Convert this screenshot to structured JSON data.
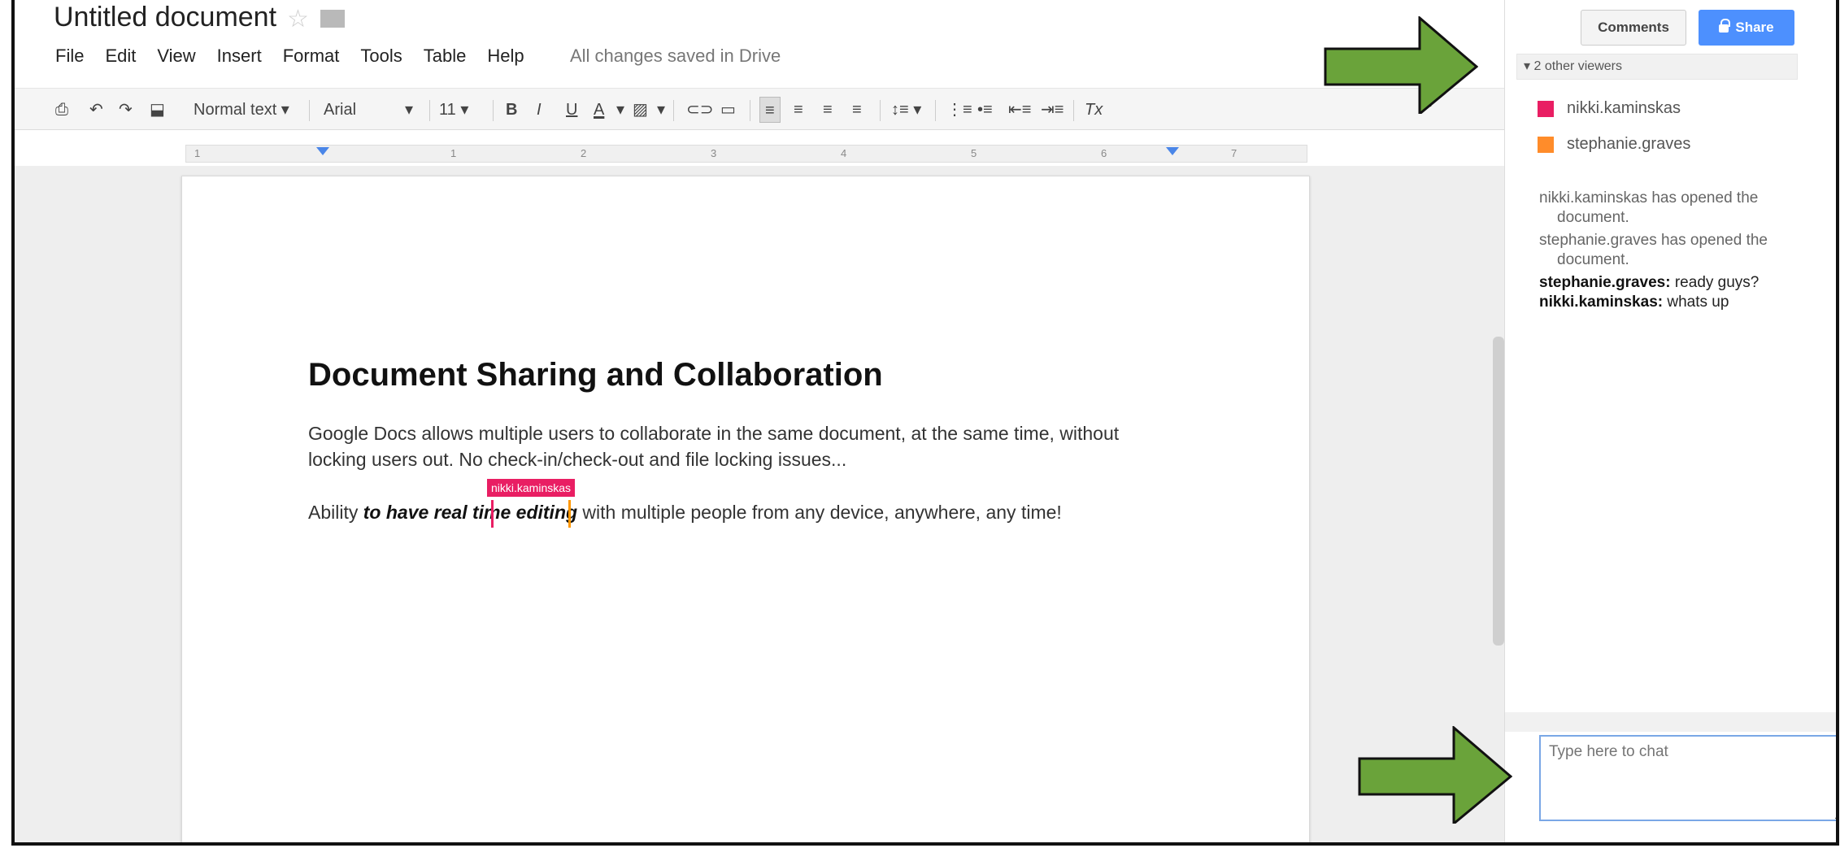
{
  "document": {
    "title": "Untitled document",
    "save_status": "All changes saved in Drive"
  },
  "menu": [
    "File",
    "Edit",
    "View",
    "Insert",
    "Format",
    "Tools",
    "Table",
    "Help"
  ],
  "toolbar": {
    "style": "Normal text",
    "font": "Arial",
    "size": "11",
    "bold": "B",
    "italic": "I",
    "underline": "U",
    "text_color": "A"
  },
  "ruler": [
    "1",
    "1",
    "2",
    "3",
    "4",
    "5",
    "6",
    "7"
  ],
  "page": {
    "heading": "Document Sharing and Collaboration",
    "paragraph1": "Google Docs allows multiple users to collaborate in the same document, at the same time, without locking users out. No check-in/check-out and file locking issues...",
    "p2_prefix": "Ability ",
    "p2_em": "to have real time editing",
    "p2_suffix": " with multiple people from any device, anywhere, any time!",
    "cursor_user": "nikki.kaminskas"
  },
  "panel": {
    "comments_label": "Comments",
    "share_label": "Share",
    "viewers_label": "▾ 2 other viewers",
    "viewers": [
      {
        "name": "nikki.kaminskas",
        "color": "#e91e63"
      },
      {
        "name": "stephanie.graves",
        "color": "#ff8c2a"
      }
    ],
    "chat_system": [
      "nikki.kaminskas has opened the document.",
      "stephanie.graves has opened the document."
    ],
    "chat_messages": [
      {
        "user": "stephanie.graves:",
        "text": " ready guys?"
      },
      {
        "user": "nikki.kaminskas:",
        "text": " whats up"
      }
    ],
    "chat_placeholder": "Type here to chat"
  },
  "colors": {
    "arrow": "#6aa33a",
    "share": "#4d90fe"
  }
}
